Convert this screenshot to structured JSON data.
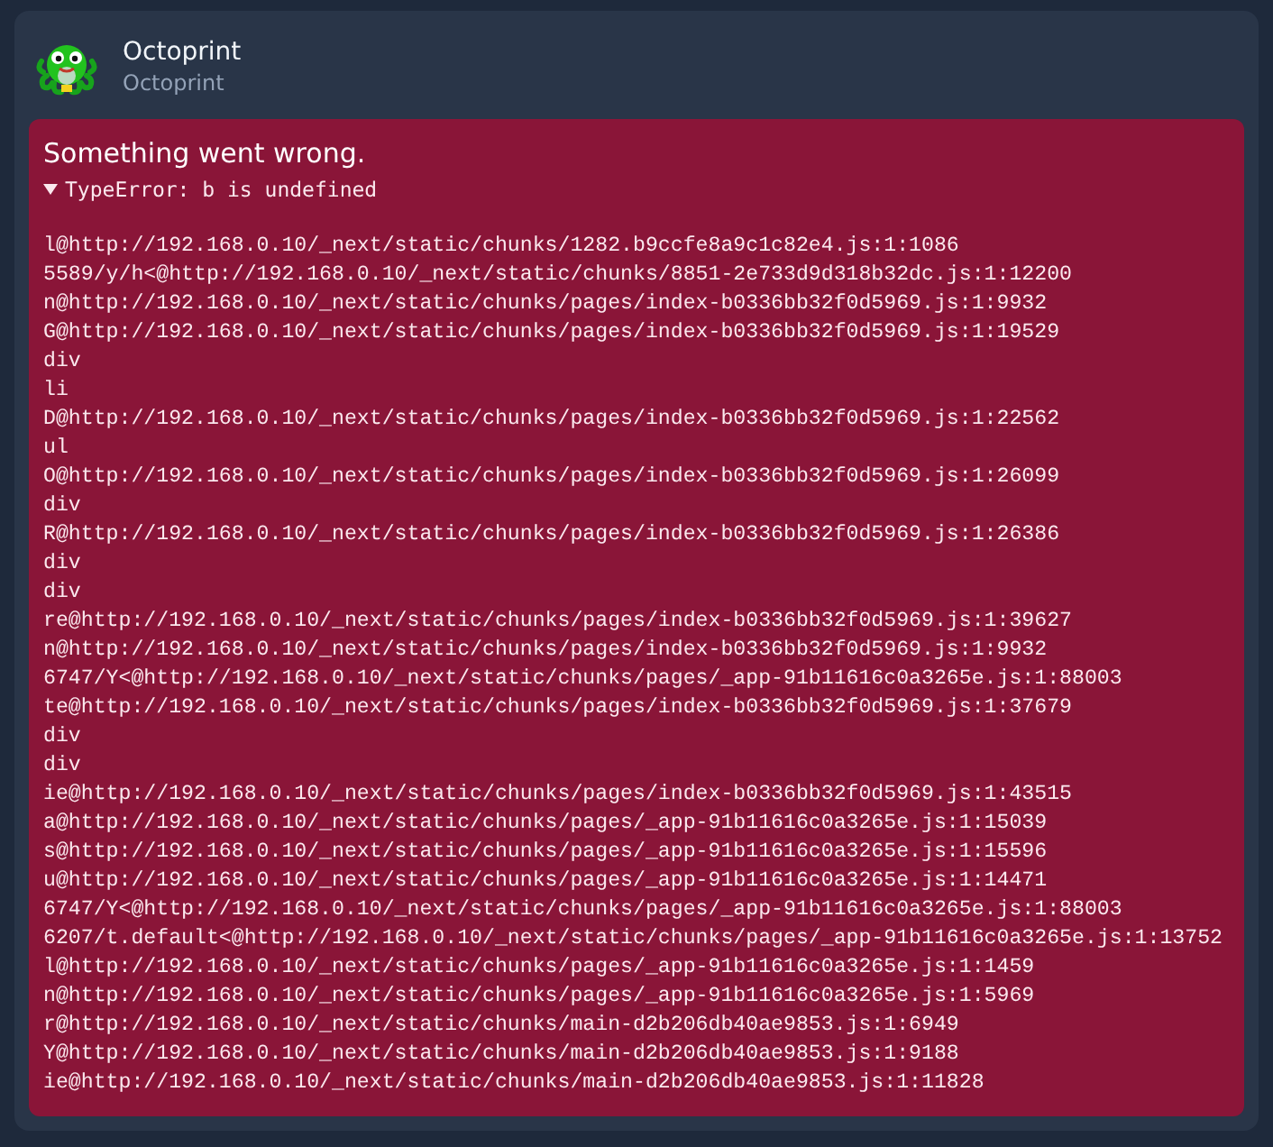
{
  "header": {
    "title": "Octoprint",
    "subtitle": "Octoprint"
  },
  "error": {
    "heading": "Something went wrong.",
    "summary": "TypeError: b is undefined",
    "expanded": true,
    "stack": [
      "l@http://192.168.0.10/_next/static/chunks/1282.b9ccfe8a9c1c82e4.js:1:1086",
      "5589/y/h<@http://192.168.0.10/_next/static/chunks/8851-2e733d9d318b32dc.js:1:12200",
      "n@http://192.168.0.10/_next/static/chunks/pages/index-b0336bb32f0d5969.js:1:9932",
      "G@http://192.168.0.10/_next/static/chunks/pages/index-b0336bb32f0d5969.js:1:19529",
      "div",
      "li",
      "D@http://192.168.0.10/_next/static/chunks/pages/index-b0336bb32f0d5969.js:1:22562",
      "ul",
      "O@http://192.168.0.10/_next/static/chunks/pages/index-b0336bb32f0d5969.js:1:26099",
      "div",
      "R@http://192.168.0.10/_next/static/chunks/pages/index-b0336bb32f0d5969.js:1:26386",
      "div",
      "div",
      "re@http://192.168.0.10/_next/static/chunks/pages/index-b0336bb32f0d5969.js:1:39627",
      "n@http://192.168.0.10/_next/static/chunks/pages/index-b0336bb32f0d5969.js:1:9932",
      "6747/Y<@http://192.168.0.10/_next/static/chunks/pages/_app-91b11616c0a3265e.js:1:88003",
      "te@http://192.168.0.10/_next/static/chunks/pages/index-b0336bb32f0d5969.js:1:37679",
      "div",
      "div",
      "ie@http://192.168.0.10/_next/static/chunks/pages/index-b0336bb32f0d5969.js:1:43515",
      "a@http://192.168.0.10/_next/static/chunks/pages/_app-91b11616c0a3265e.js:1:15039",
      "s@http://192.168.0.10/_next/static/chunks/pages/_app-91b11616c0a3265e.js:1:15596",
      "u@http://192.168.0.10/_next/static/chunks/pages/_app-91b11616c0a3265e.js:1:14471",
      "6747/Y<@http://192.168.0.10/_next/static/chunks/pages/_app-91b11616c0a3265e.js:1:88003",
      "6207/t.default<@http://192.168.0.10/_next/static/chunks/pages/_app-91b11616c0a3265e.js:1:13752",
      "l@http://192.168.0.10/_next/static/chunks/pages/_app-91b11616c0a3265e.js:1:1459",
      "n@http://192.168.0.10/_next/static/chunks/pages/_app-91b11616c0a3265e.js:1:5969",
      "r@http://192.168.0.10/_next/static/chunks/main-d2b206db40ae9853.js:1:6949",
      "Y@http://192.168.0.10/_next/static/chunks/main-d2b206db40ae9853.js:1:9188",
      "ie@http://192.168.0.10/_next/static/chunks/main-d2b206db40ae9853.js:1:11828"
    ]
  }
}
